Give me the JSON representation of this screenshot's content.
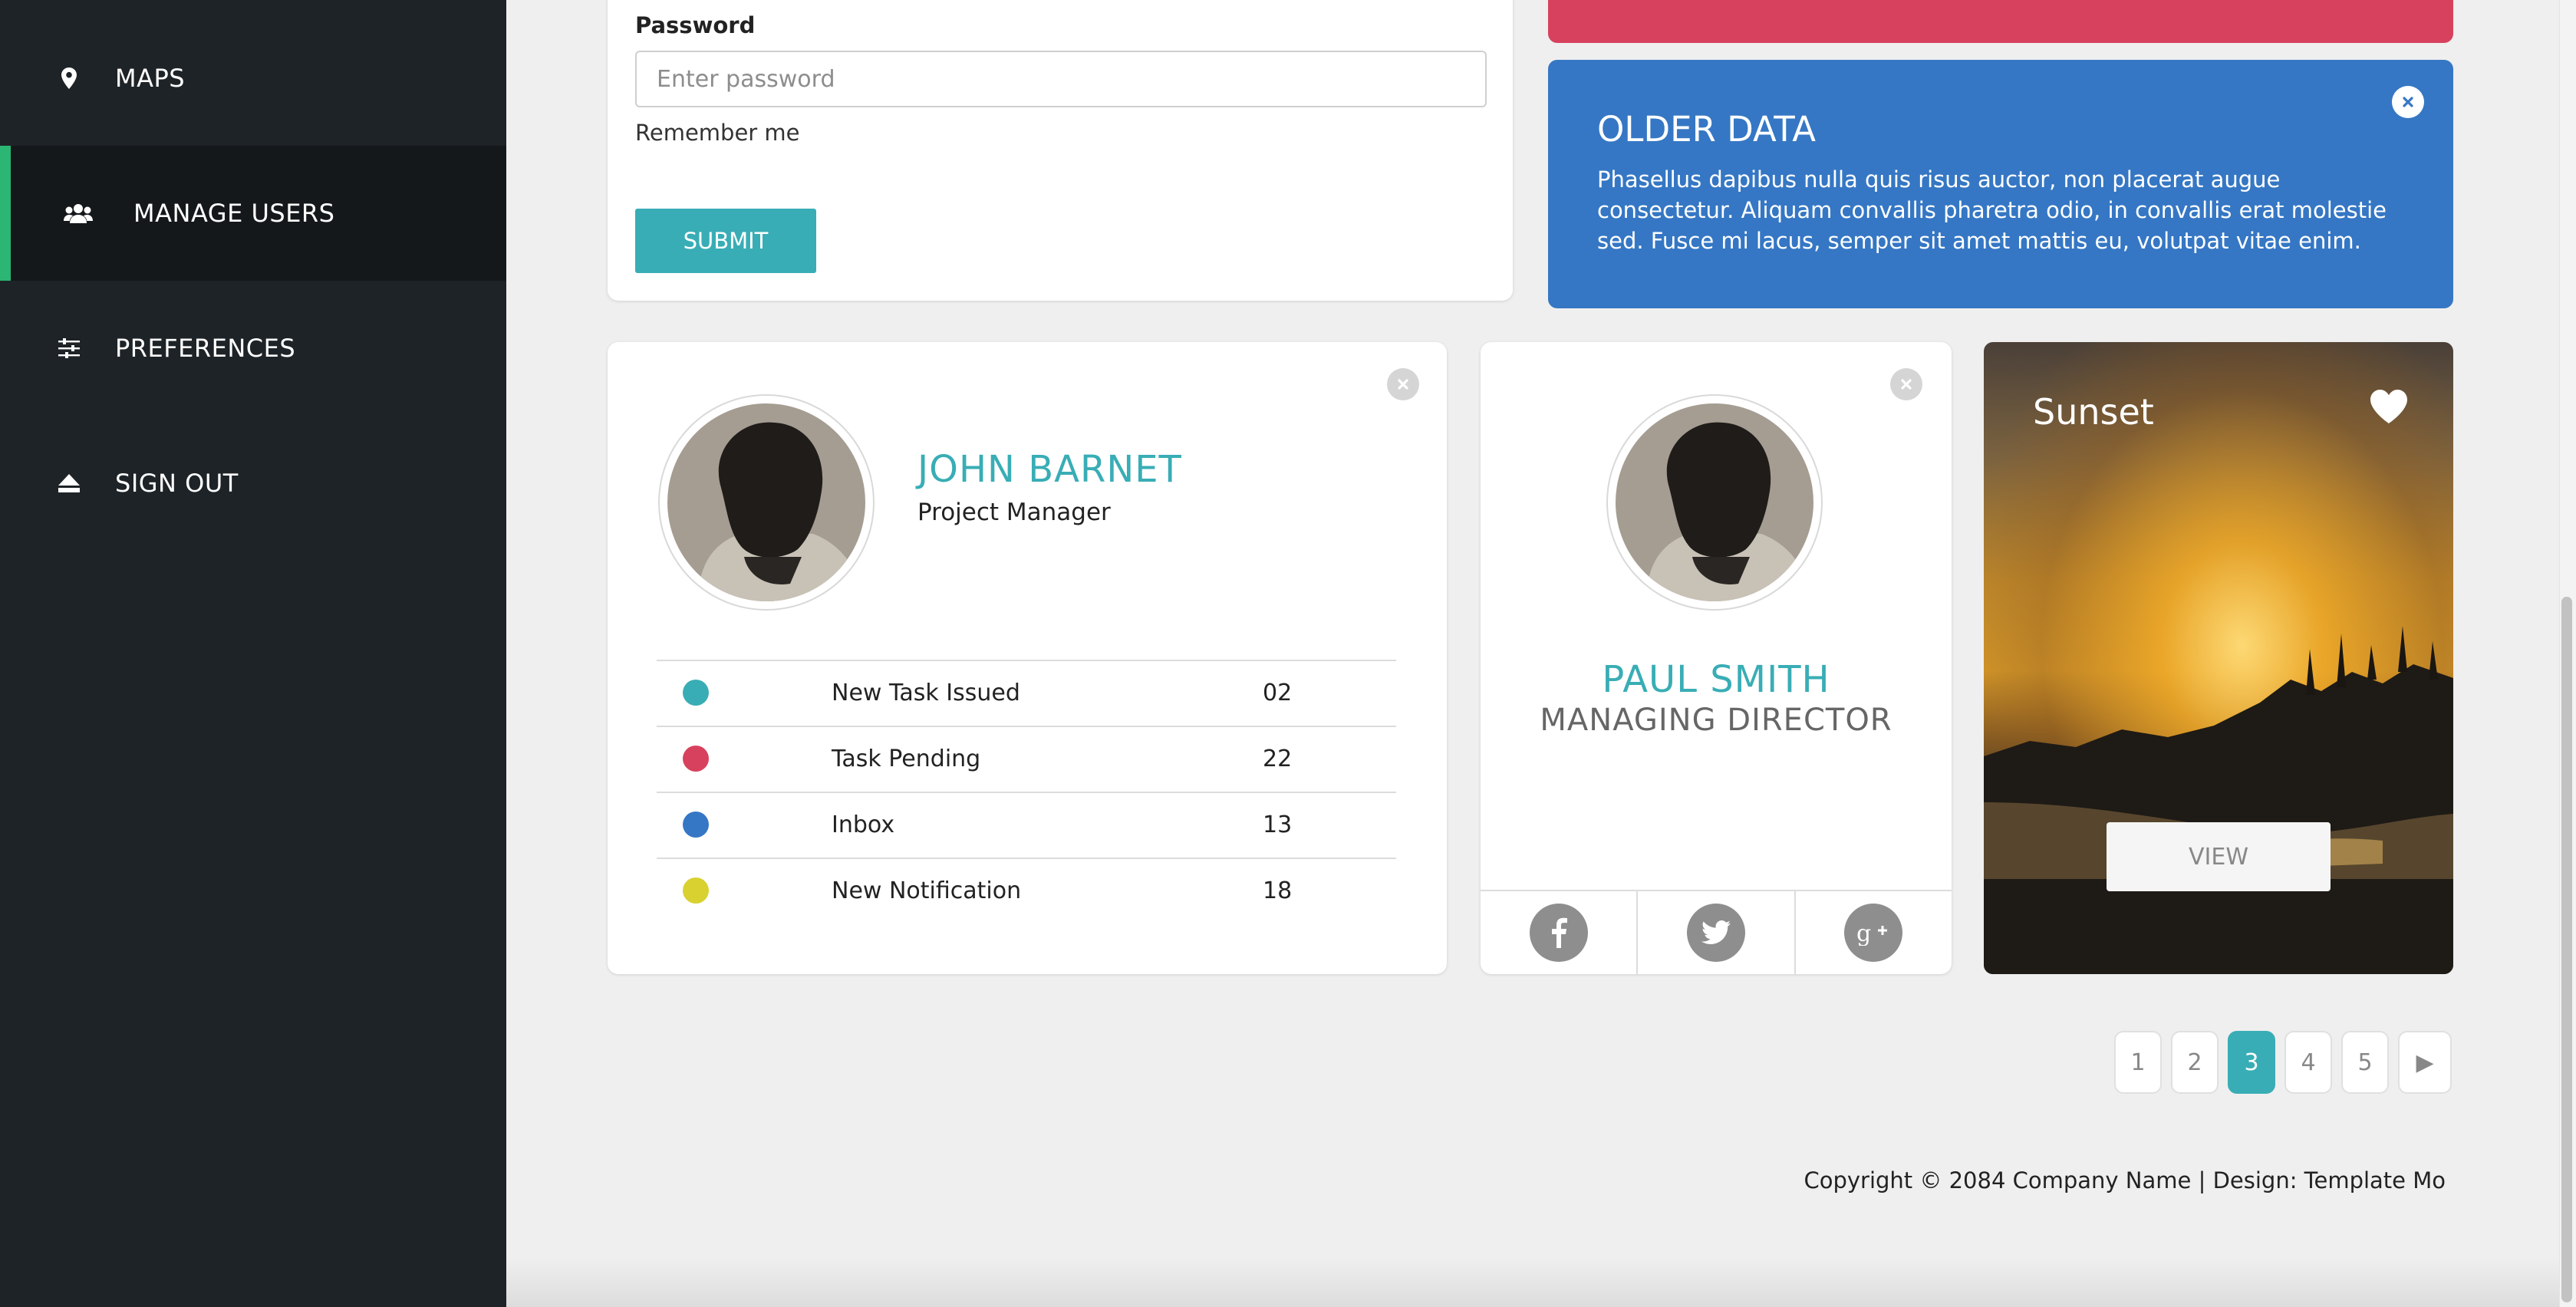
{
  "sidebar": {
    "items": [
      {
        "label": "MAPS",
        "icon": "map-pin-icon"
      },
      {
        "label": "MANAGE USERS",
        "icon": "users-icon",
        "active": true
      },
      {
        "label": "PREFERENCES",
        "icon": "sliders-icon"
      },
      {
        "label": "SIGN OUT",
        "icon": "eject-icon"
      }
    ]
  },
  "login": {
    "password_label": "Password",
    "password_placeholder": "Enter password",
    "remember_label": "Remember me",
    "submit_label": "SUBMIT"
  },
  "older_data": {
    "title": "OLDER DATA",
    "text": "Phasellus dapibus nulla quis risus auctor, non placerat augue consectetur. Aliquam convallis pharetra odio, in convallis erat molestie sed. Fusce mi lacus, semper sit amet mattis eu, volutpat vitae enim."
  },
  "profile": {
    "name": "JOHN BARNET",
    "role": "Project Manager",
    "stats": [
      {
        "label": "New Task Issued",
        "count": "02",
        "color": "#39adb5"
      },
      {
        "label": "Task Pending",
        "count": "22",
        "color": "#d7415d"
      },
      {
        "label": "Inbox",
        "count": "13",
        "color": "#3577c4"
      },
      {
        "label": "New Notification",
        "count": "18",
        "color": "#d8d12f"
      }
    ]
  },
  "contact": {
    "name": "PAUL SMITH",
    "role": "MANAGING DIRECTOR",
    "social": [
      "facebook-icon",
      "twitter-icon",
      "google-plus-icon"
    ]
  },
  "photo": {
    "title": "Sunset",
    "view_label": "VIEW"
  },
  "pagination": {
    "pages": [
      "1",
      "2",
      "3",
      "4",
      "5"
    ],
    "current": "3",
    "next_label": "▶"
  },
  "footer": {
    "text": "Copyright © 2084 Company Name | Design: Template Mo"
  },
  "colors": {
    "sidebar_bg": "#1e2327",
    "active_indicator": "#2bb673",
    "accent": "#39adb5",
    "red": "#d7415d",
    "blue": "#3577c4"
  }
}
